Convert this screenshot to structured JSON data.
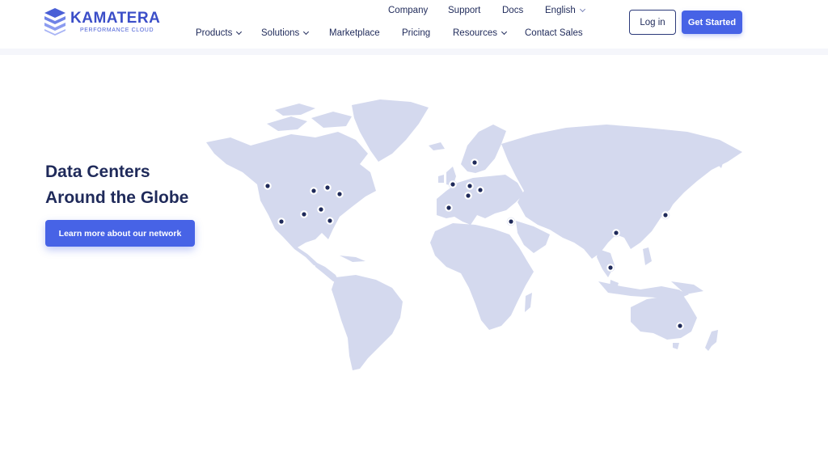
{
  "header": {
    "logo": {
      "name": "KAMATERA",
      "tagline": "PERFORMANCE CLOUD"
    },
    "top_nav": [
      {
        "label": "Company"
      },
      {
        "label": "Support"
      },
      {
        "label": "Docs"
      },
      {
        "label": "English"
      }
    ],
    "main_nav": [
      {
        "label": "Products"
      },
      {
        "label": "Solutions"
      },
      {
        "label": "Marketplace"
      },
      {
        "label": "Pricing"
      },
      {
        "label": "Resources"
      },
      {
        "label": "Contact Sales"
      }
    ],
    "login_label": "Log in",
    "get_started_label": "Get Started"
  },
  "hero": {
    "title_line1": "Data Centers",
    "title_line2": "Around the Globe",
    "cta_label": "Learn more about our network"
  },
  "colors": {
    "brand": "#4763e6",
    "text": "#1f2a5a",
    "map_land": "#d4d9ee"
  },
  "icons": [
    "kamatera-logo-icon",
    "chevron-down-icon",
    "data-center-marker-icon",
    "world-map"
  ]
}
